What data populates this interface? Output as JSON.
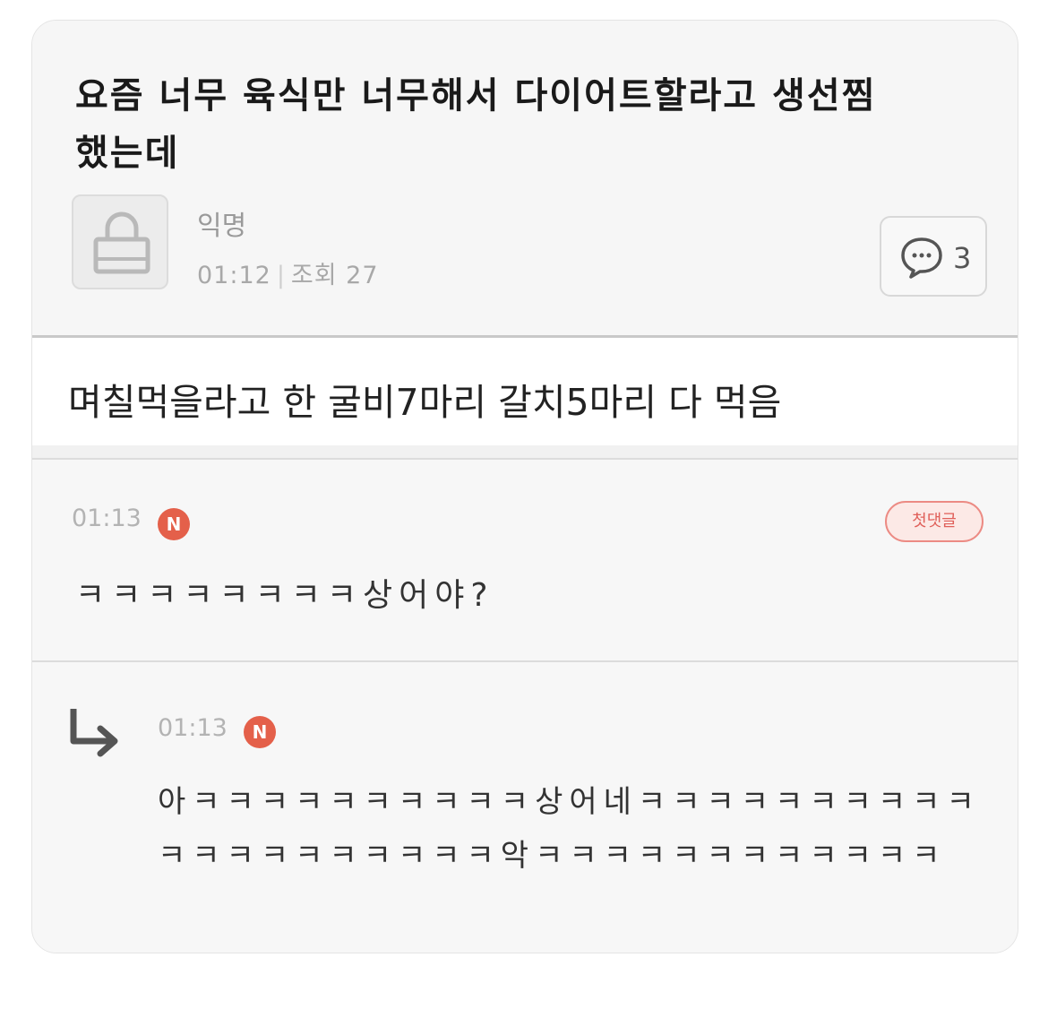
{
  "post": {
    "title": "요즘 너무 육식만 너무해서 다이어트할라고 생선찜했는데",
    "author": "익명",
    "time": "01:12",
    "views": "조회 27",
    "comment_count": "3",
    "body": "며칠먹을라고 한 굴비7마리 갈치5마리 다 먹음"
  },
  "comments": [
    {
      "time": "01:13",
      "badge": "N",
      "first_label": "첫댓글",
      "text": "ㅋㅋㅋㅋㅋㅋㅋㅋ상어야?"
    }
  ],
  "replies": [
    {
      "time": "01:13",
      "badge": "N",
      "text": "아ㅋㅋㅋㅋㅋㅋㅋㅋㅋㅋ상어네ㅋㅋㅋㅋㅋㅋㅋㅋㅋㅋㅋㅋㅋㅋㅋㅋㅋㅋㅋㅋ악ㅋㅋㅋㅋㅋㅋㅋㅋㅋㅋㅋㅋ"
    }
  ],
  "icons": {
    "avatar": "lock-icon",
    "comment": "speech-bubble-icon",
    "reply": "reply-arrow-icon"
  },
  "colors": {
    "badge": "#e4604a",
    "first_comment_border": "#ec8b84"
  }
}
